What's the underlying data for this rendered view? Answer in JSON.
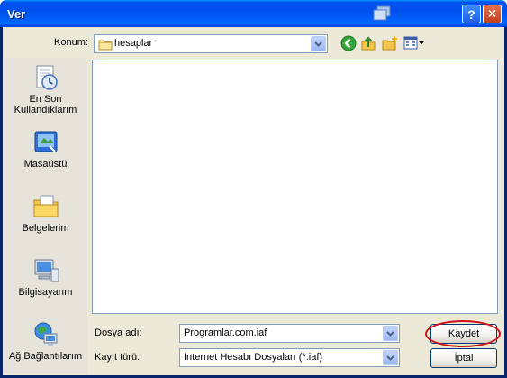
{
  "window": {
    "title": "Ver"
  },
  "titlebar": {
    "help_glyph": "?",
    "close_glyph": "✕"
  },
  "location": {
    "label": "Konum:",
    "value": "hesaplar",
    "icon": "folder-icon"
  },
  "toolbar": {
    "icons": [
      "back-icon",
      "up-folder-icon",
      "new-folder-icon",
      "views-menu-icon"
    ]
  },
  "places": [
    {
      "label": "En Son\nKullandıklarım",
      "icon": "recent-documents-icon"
    },
    {
      "label": "Masaüstü",
      "icon": "desktop-icon"
    },
    {
      "label": "Belgelerim",
      "icon": "my-documents-icon"
    },
    {
      "label": "Bilgisayarım",
      "icon": "my-computer-icon"
    },
    {
      "label": "Ağ Bağlantılarım",
      "icon": "network-places-icon"
    }
  ],
  "form": {
    "filename_label": "Dosya adı:",
    "filename_value": "Programlar.com.iaf",
    "filetype_label": "Kayıt türü:",
    "filetype_value": "Internet Hesabı Dosyaları (*.iaf)"
  },
  "buttons": {
    "save": "Kaydet",
    "cancel": "İptal"
  },
  "colors": {
    "titlebar": "#0053ee",
    "dialog_bg": "#ece9d8",
    "highlight_ring": "#d0101a"
  }
}
